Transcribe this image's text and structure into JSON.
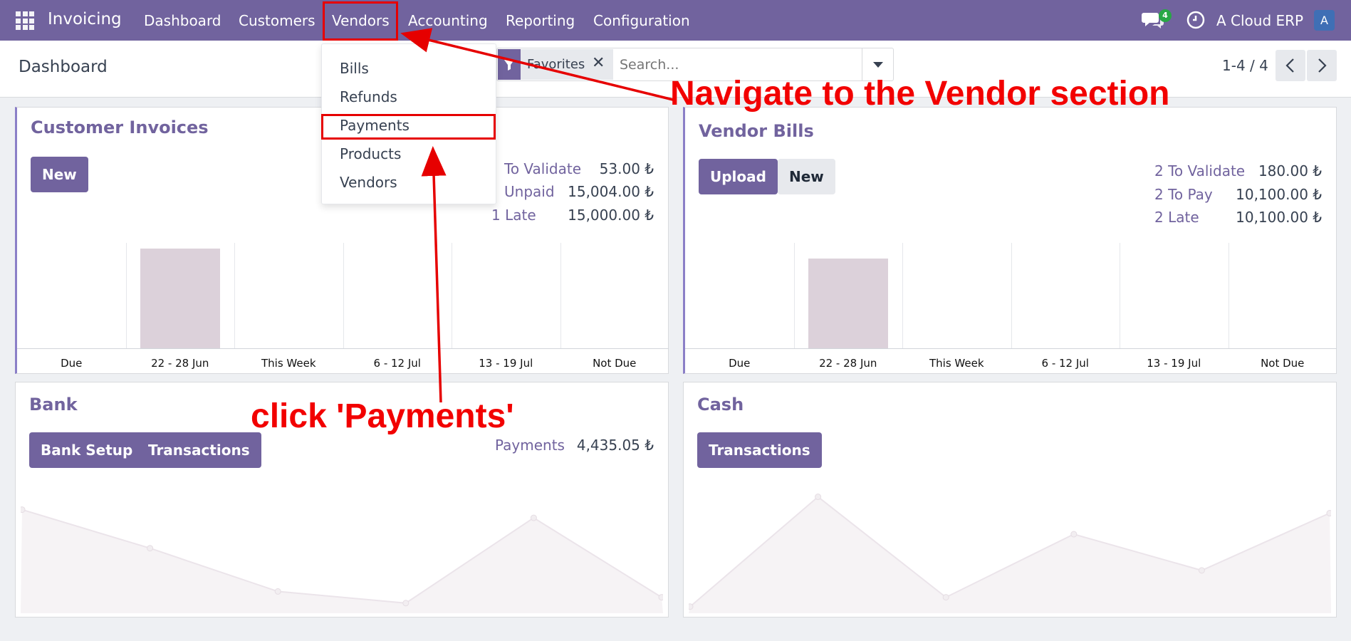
{
  "nav": {
    "brand": "Invoicing",
    "items": [
      "Dashboard",
      "Customers",
      "Vendors",
      "Accounting",
      "Reporting",
      "Configuration"
    ],
    "chat_badge": "4",
    "company": "A Cloud ERP",
    "avatar": "A"
  },
  "control": {
    "title": "Dashboard",
    "facet": "Favorites",
    "search_placeholder": "Search...",
    "pager": "1-4 / 4"
  },
  "vendors_menu": {
    "items": [
      "Bills",
      "Refunds",
      "Payments",
      "Products",
      "Vendors"
    ]
  },
  "customer_invoices": {
    "title": "Customer Invoices",
    "new_label": "New",
    "stats": [
      {
        "label": "To Validate",
        "value": "53.00 ₺"
      },
      {
        "label": "Unpaid",
        "value": "15,004.00 ₺"
      },
      {
        "label": "1 Late",
        "value": "15,000.00 ₺"
      }
    ]
  },
  "vendor_bills": {
    "title": "Vendor Bills",
    "upload_label": "Upload",
    "new_label": "New",
    "stats": [
      {
        "label": "2 To Validate",
        "value": "180.00 ₺"
      },
      {
        "label": "2 To Pay",
        "value": "10,100.00 ₺"
      },
      {
        "label": "2 Late",
        "value": "10,100.00 ₺"
      }
    ]
  },
  "bank": {
    "title": "Bank",
    "setup_label": "Bank Setup",
    "transactions_label": "Transactions",
    "payments_label": "Payments",
    "payments_value": "4,435.05 ₺"
  },
  "cash": {
    "title": "Cash",
    "transactions_label": "Transactions"
  },
  "annotations": {
    "navigate": "Navigate to the Vendor section",
    "click": "click 'Payments'"
  },
  "chart_data": [
    {
      "type": "bar",
      "categories": [
        "Due",
        "22 - 28 Jun",
        "This Week",
        "6 - 12 Jul",
        "13 - 19 Jul",
        "Not Due"
      ],
      "values": [
        0,
        1,
        0,
        0,
        0,
        0
      ]
    },
    {
      "type": "bar",
      "categories": [
        "Due",
        "22 - 28 Jun",
        "This Week",
        "6 - 12 Jul",
        "13 - 19 Jul",
        "Not Due"
      ],
      "values": [
        0,
        0.9,
        0,
        0,
        0,
        0
      ]
    },
    {
      "type": "area",
      "values": [
        0.85,
        0.52,
        0.15,
        0.05,
        0.78,
        0.1
      ]
    },
    {
      "type": "area",
      "values": [
        0.02,
        0.96,
        0.1,
        0.64,
        0.33,
        0.82
      ]
    }
  ],
  "colors": {
    "primary": "#71639e",
    "annotation": "#e60000",
    "bar": "#dcd1da"
  }
}
